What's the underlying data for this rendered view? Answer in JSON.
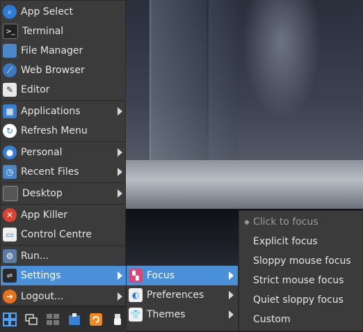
{
  "main_menu": {
    "items": [
      {
        "label": "App Select",
        "icon": "search-icon"
      },
      {
        "label": "Terminal",
        "icon": "terminal-icon"
      },
      {
        "label": "File Manager",
        "icon": "folder-icon"
      },
      {
        "label": "Web Browser",
        "icon": "globe-icon"
      },
      {
        "label": "Editor",
        "icon": "editor-icon"
      },
      {
        "label": "Applications",
        "icon": "applications-icon"
      },
      {
        "label": "Refresh Menu",
        "icon": "refresh-icon"
      },
      {
        "label": "Personal",
        "icon": "user-icon"
      },
      {
        "label": "Recent Files",
        "icon": "recent-folder-icon"
      },
      {
        "label": "Desktop",
        "icon": "desktop-icon"
      },
      {
        "label": "App Killer",
        "icon": "close-icon"
      },
      {
        "label": "Control Centre",
        "icon": "control-centre-icon"
      },
      {
        "label": "Run...",
        "icon": "run-gear-icon"
      },
      {
        "label": "Settings",
        "icon": "settings-icon"
      },
      {
        "label": "Logout...",
        "icon": "logout-icon"
      }
    ]
  },
  "settings_submenu": {
    "items": [
      {
        "label": "Focus",
        "icon": "focus-icon"
      },
      {
        "label": "Preferences",
        "icon": "preferences-icon"
      },
      {
        "label": "Themes",
        "icon": "themes-icon"
      }
    ]
  },
  "focus_submenu": {
    "items": [
      {
        "label": "Click to focus",
        "selected": true
      },
      {
        "label": "Explicit focus"
      },
      {
        "label": "Sloppy mouse focus"
      },
      {
        "label": "Strict mouse focus"
      },
      {
        "label": "Quiet sloppy focus"
      },
      {
        "label": "Custom"
      }
    ]
  },
  "taskbar": {
    "icons": [
      "windows-grid-icon",
      "window-list-icon",
      "workspaces-icon",
      "package-icon",
      "reload-icon",
      "usb-icon"
    ]
  },
  "colors": {
    "menu_bg": "#3b3b3b",
    "highlight": "#4a90d9",
    "text": "#e6e6e6",
    "disabled_text": "#9a9a9a"
  }
}
